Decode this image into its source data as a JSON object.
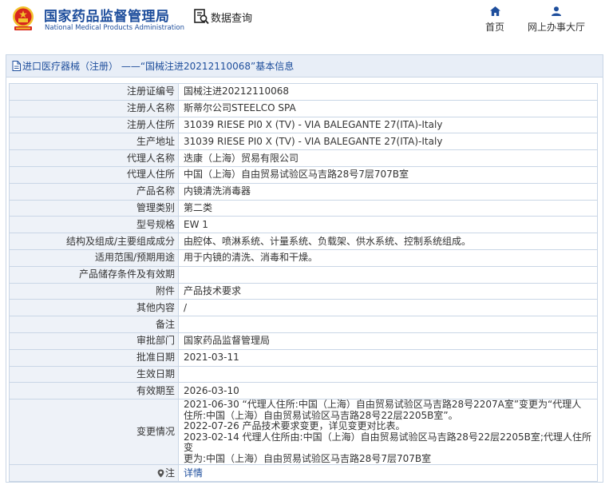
{
  "header": {
    "brand_cn": "国家药品监督管理局",
    "brand_en": "National Medical Products Administration",
    "query_label": "数据查询",
    "nav": [
      {
        "label": "首页",
        "icon": "home-icon"
      },
      {
        "label": "网上办事大厅",
        "icon": "user-icon"
      }
    ]
  },
  "breadcrumb": {
    "text": "进口医疗器械（注册） ——“国械注进20212110068”基本信息"
  },
  "rows": [
    {
      "label": "注册证编号",
      "value": "国械注进20212110068"
    },
    {
      "label": "注册人名称",
      "value": "斯蒂尔公司STEELCO SPA"
    },
    {
      "label": "注册人住所",
      "value": "31039 RIESE PI0 X (TV) - VIA BALEGANTE 27(ITA)-Italy"
    },
    {
      "label": "生产地址",
      "value": "31039 RIESE PI0 X (TV) - VIA BALEGANTE 27(ITA)-Italy"
    },
    {
      "label": "代理人名称",
      "value": "迭康（上海）贸易有限公司"
    },
    {
      "label": "代理人住所",
      "value": "中国（上海）自由贸易试验区马吉路28号7层707B室"
    },
    {
      "label": "产品名称",
      "value": "内镜清洗消毒器"
    },
    {
      "label": "管理类别",
      "value": "第二类"
    },
    {
      "label": "型号规格",
      "value": "EW 1"
    },
    {
      "label": "结构及组成/主要组成成分",
      "value": "由腔体、喷淋系统、计量系统、负载架、供水系统、控制系统组成。"
    },
    {
      "label": "适用范围/预期用途",
      "value": "用于内镜的清洗、消毒和干燥。"
    },
    {
      "label": "产品储存条件及有效期",
      "value": ""
    },
    {
      "label": "附件",
      "value": "产品技术要求"
    },
    {
      "label": "其他内容",
      "value": "/"
    },
    {
      "label": "备注",
      "value": ""
    },
    {
      "label": "审批部门",
      "value": "国家药品监督管理局"
    },
    {
      "label": "批准日期",
      "value": "2021-03-11"
    },
    {
      "label": "生效日期",
      "value": ""
    },
    {
      "label": "有效期至",
      "value": "2026-03-10"
    }
  ],
  "change": {
    "label": "变更情况",
    "lines": [
      "2021-06-30 “代理人住所:中国（上海）自由贸易试验区马吉路28号2207A室”变更为“代理人",
      "住所:中国（上海）自由贸易试验区马吉路28号22层2205B室”。",
      "2022-07-26 产品技术要求变更，详见变更对比表。",
      "2023-02-14 代理人住所由:中国（上海）自由贸易试验区马吉路28号22层2205B室;代理人住所变",
      "更为:中国（上海）自由贸易试验区马吉路28号7层707B室"
    ]
  },
  "note": {
    "label": "注",
    "link": "详情"
  },
  "colors": {
    "brand_blue": "#1e4e9c",
    "label_bg": "#eef2f8",
    "border": "#c9d6e6",
    "emblem_red": "#d7261e",
    "emblem_gold": "#f2c22c"
  }
}
